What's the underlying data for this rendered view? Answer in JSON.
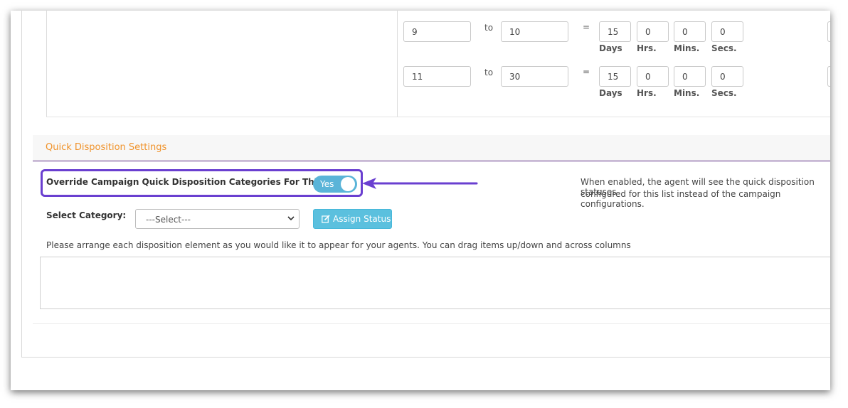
{
  "ranges": [
    {
      "from": "9",
      "to_word": "to",
      "to": "10",
      "equals": "=",
      "days": "15",
      "hrs": "0",
      "mins": "0",
      "secs": "0"
    },
    {
      "from": "11",
      "to_word": "to",
      "to": "30",
      "equals": "=",
      "days": "15",
      "hrs": "0",
      "mins": "0",
      "secs": "0"
    }
  ],
  "units": {
    "days": "Days",
    "hrs": "Hrs.",
    "mins": "Mins.",
    "secs": "Secs."
  },
  "quick_disposition": {
    "section_title": "Quick Disposition Settings",
    "override_label": "Override Campaign Quick Disposition Categories For This List:",
    "toggle_label": "Yes",
    "toggle_on": true,
    "help_line1": "When enabled, the agent will see the quick disposition statuses",
    "help_line2": "configured for this list instead of the campaign configurations.",
    "select_category_label": "Select Category:",
    "select_value": "---Select---",
    "assign_button": "Assign Status",
    "instructions": "Please arrange each disposition element as you would like it to appear for your agents. You can drag items up/down and across columns"
  },
  "colors": {
    "accent_orange": "#f0932b",
    "toggle_blue": "#5ab4d8",
    "highlight_purple": "#6a3fd0",
    "button_blue": "#5bc0de",
    "rule_purple": "#5a2a84"
  }
}
